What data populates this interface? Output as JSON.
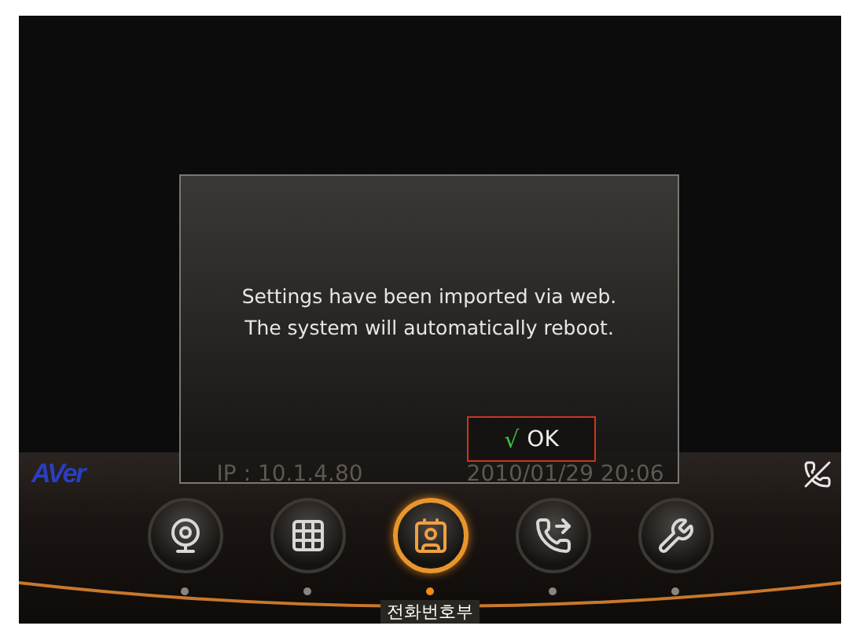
{
  "dialog": {
    "message": [
      "Settings have been imported via web.",
      "The system will automatically reboot."
    ],
    "button": {
      "mark": "√",
      "label": "OK"
    }
  },
  "status_bar": {
    "logo": "AVer",
    "ip": "IP : 10.1.4.80",
    "datetime": "2010/01/29 20:06"
  },
  "dock": {
    "items": [
      {
        "kind": "camera",
        "selected": false
      },
      {
        "kind": "keypad",
        "selected": false
      },
      {
        "kind": "phonebook",
        "selected": true,
        "label": "전화번호부"
      },
      {
        "kind": "transfer",
        "selected": false
      },
      {
        "kind": "settings",
        "selected": false
      }
    ]
  }
}
